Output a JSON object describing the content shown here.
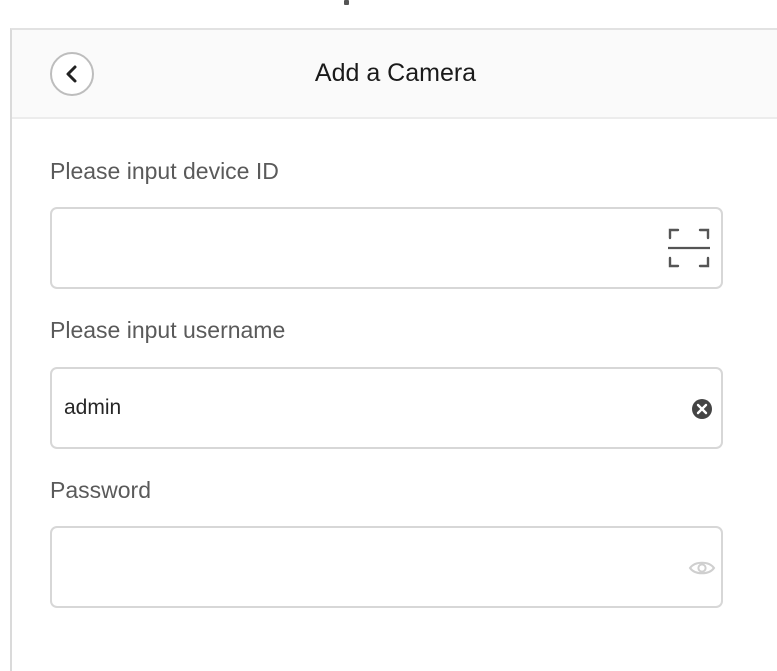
{
  "header": {
    "title": "Add a Camera",
    "back_icon": "chevron-left-icon"
  },
  "form": {
    "device_id": {
      "label": "Please input device ID",
      "value": "",
      "placeholder": "",
      "trailing_icon": "scan-icon"
    },
    "username": {
      "label": "Please input username",
      "value": "admin",
      "placeholder": "",
      "trailing_icon": "clear-icon"
    },
    "password": {
      "label": "Password",
      "value": "",
      "placeholder": "",
      "trailing_icon": "eye-icon"
    }
  },
  "colors": {
    "accent_text": "#1a1a1a",
    "label_text": "#5a5a5a",
    "border": "#d7d7d7",
    "header_bg": "#fafafa"
  }
}
